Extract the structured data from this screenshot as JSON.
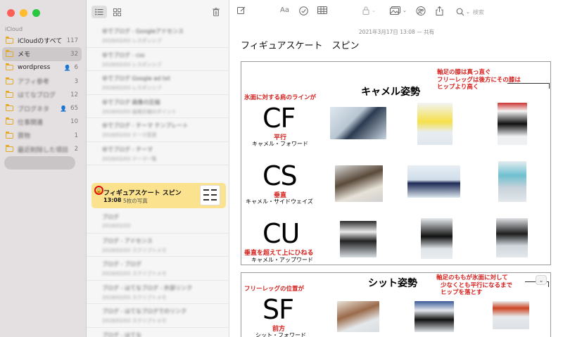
{
  "sidebar": {
    "section": "iCloud",
    "folders": [
      {
        "name": "iCloudのすべて",
        "count": "117",
        "shared": false,
        "blurred": false
      },
      {
        "name": "メモ",
        "count": "32",
        "shared": false,
        "blurred": false,
        "active": true
      },
      {
        "name": "wordpress",
        "count": "6",
        "shared": true,
        "blurred": false
      },
      {
        "name": "アフィ参考",
        "count": "3",
        "shared": false,
        "blurred": true
      },
      {
        "name": "はてなブログ",
        "count": "12",
        "shared": false,
        "blurred": true
      },
      {
        "name": "ブログネタ",
        "count": "65",
        "shared": true,
        "blurred": true
      },
      {
        "name": "仕事関連",
        "count": "10",
        "shared": false,
        "blurred": true
      },
      {
        "name": "買物",
        "count": "1",
        "shared": false,
        "blurred": true
      },
      {
        "name": "最近削除した項目",
        "count": "2",
        "shared": false,
        "blurred": true
      }
    ]
  },
  "notes_list": {
    "rows_above": [
      {
        "title": "ゆでブログ - Googleアドセンス",
        "sub": "2018/02/03  レスポンシブ"
      },
      {
        "title": "ゆでブログ - css",
        "sub": "2018/02/03  レスポンシブ"
      },
      {
        "title": "ゆでブログ Google ad txt",
        "sub": "2018/02/03  レスポンシブ"
      },
      {
        "title": "ゆでブログ 画像の圧縮",
        "sub": "2018/02/03  画像圧縮のポイント"
      },
      {
        "title": "ゆでブログ - テーマ テンプレート",
        "sub": "2018/02/03  テーマ変更"
      },
      {
        "title": "ゆでブログ - テーマ",
        "sub": "2018/02/03  テーマ一覧"
      }
    ],
    "selected": {
      "title": "フィギュアスケート スピン",
      "time": "13:08",
      "subtitle": "5枚の写真",
      "lock_icon": "lock-icon"
    },
    "rows_below": [
      {
        "title": "ブログ",
        "sub": "2018/02/03"
      },
      {
        "title": "ブログ - アドセンス",
        "sub": "2018/02/03  スクリプトメモ"
      },
      {
        "title": "ブログ - ブログ",
        "sub": "2018/02/03  スクリプトメモ"
      },
      {
        "title": "ブログ - はてなブログ - 外部リンク",
        "sub": "2018/02/03  スクリプトメモ"
      },
      {
        "title": "ブログ - はてなブログでのリンク",
        "sub": "2018/02/03  スクリプトメモ"
      },
      {
        "title": "ブログ - はてな",
        "sub": "2018/02/03  ブログ"
      }
    ]
  },
  "editor": {
    "search_placeholder": "検索",
    "date_line": "2021年3月17日 13:08 — 共有",
    "title": "フィギュアスケート　スピン"
  },
  "panel1": {
    "heading": "キャメル姿勢",
    "note_top_right": [
      "軸足の膝は真っ直ぐ",
      "フリーレッグは後方にその膝は",
      "ヒップより高く"
    ],
    "note_left": "氷面に対する肩のラインが",
    "rows": [
      {
        "code": "CF",
        "red": "平行",
        "black": "キャメル・フォワード"
      },
      {
        "code": "CS",
        "red": "垂直",
        "black": "キャメル・サイドウェイズ"
      },
      {
        "code": "CU",
        "red": "垂直を超えて上にひねる",
        "black": "キャメル・アップワード"
      }
    ]
  },
  "panel2": {
    "heading": "シット姿勢",
    "note_right": [
      "軸足のももが氷面に対して",
      "少なくとも平行になるまで",
      "ヒップを落とす"
    ],
    "note_left": "フリーレッグの位置が",
    "rows": [
      {
        "code": "SF",
        "red": "前方",
        "black": "シット・フォワード"
      }
    ]
  },
  "colors": {
    "sidebar_bg": "#e4dfe1",
    "folder_icon": "#e5a823",
    "selected_note": "#fbe28e",
    "annotation_red": "#d6201c"
  }
}
